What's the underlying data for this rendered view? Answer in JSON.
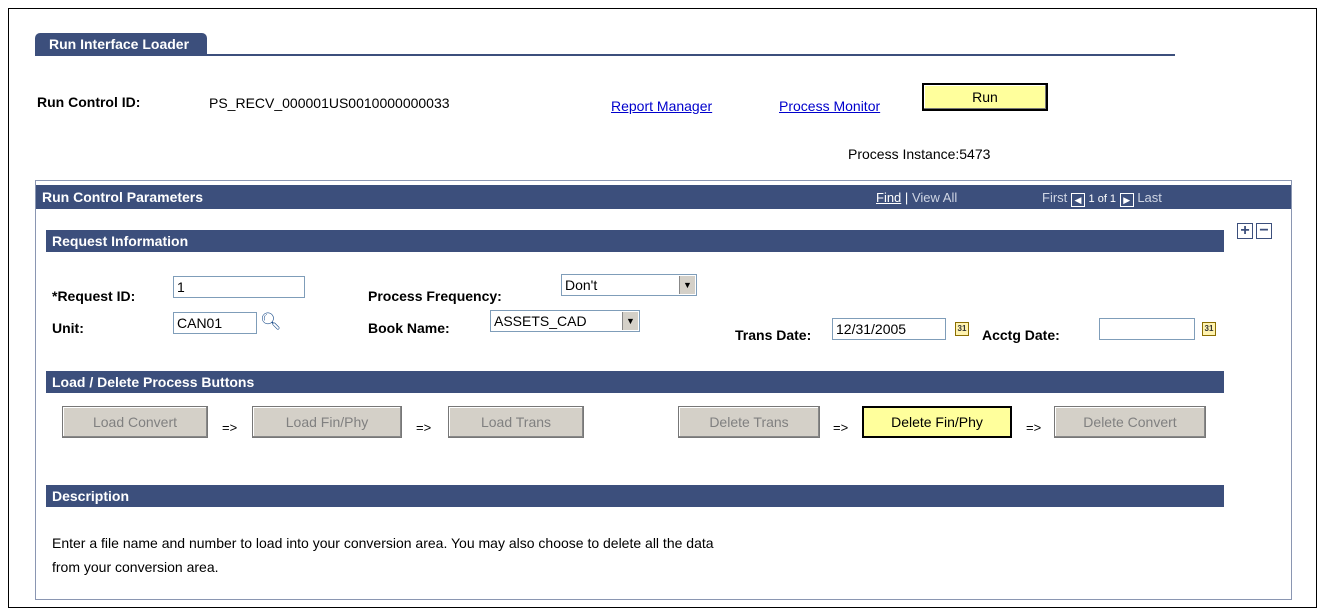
{
  "tab": {
    "title": "Run Interface Loader"
  },
  "header": {
    "run_control_label": "Run Control ID:",
    "run_control_value": "PS_RECV_000001US0010000000033",
    "report_manager": "Report Manager",
    "process_monitor": "Process Monitor",
    "run_button": "Run",
    "process_instance": "Process Instance:5473"
  },
  "params": {
    "title": "Run Control Parameters",
    "find": "Find",
    "pipe": "|",
    "view_all": "View All",
    "first": "First",
    "count": "1 of 1",
    "last": "Last"
  },
  "request": {
    "title": "Request Information",
    "request_id_label": "*Request ID:",
    "request_id_value": "1",
    "unit_label": "Unit:",
    "unit_value": "CAN01",
    "process_frequency_label": "Process Frequency:",
    "process_frequency_value": "Don't",
    "book_name_label": "Book Name:",
    "book_name_value": "ASSETS_CAD",
    "trans_date_label": "Trans Date:",
    "trans_date_value": "12/31/2005",
    "acctg_date_label": "Acctg Date:",
    "acctg_date_value": ""
  },
  "buttons": {
    "title": "Load / Delete Process Buttons",
    "load_convert": "Load Convert",
    "load_fin_phy": "Load Fin/Phy",
    "load_trans": "Load Trans",
    "delete_trans": "Delete Trans",
    "delete_fin_phy": "Delete Fin/Phy",
    "delete_convert": "Delete Convert",
    "arrow": "=>"
  },
  "description": {
    "title": "Description",
    "line1": "Enter a file name and number to load into your conversion area. You may also choose to delete all the data",
    "line2": "from your conversion area."
  },
  "colors": {
    "bar": "#3c4f7c",
    "button_active": "#ffff9c",
    "link": "#0000cc"
  },
  "icons": [
    "lookup-magnifier-icon",
    "calendar-icon",
    "add-row-icon",
    "delete-row-icon",
    "prev-arrow-icon",
    "next-arrow-icon"
  ]
}
